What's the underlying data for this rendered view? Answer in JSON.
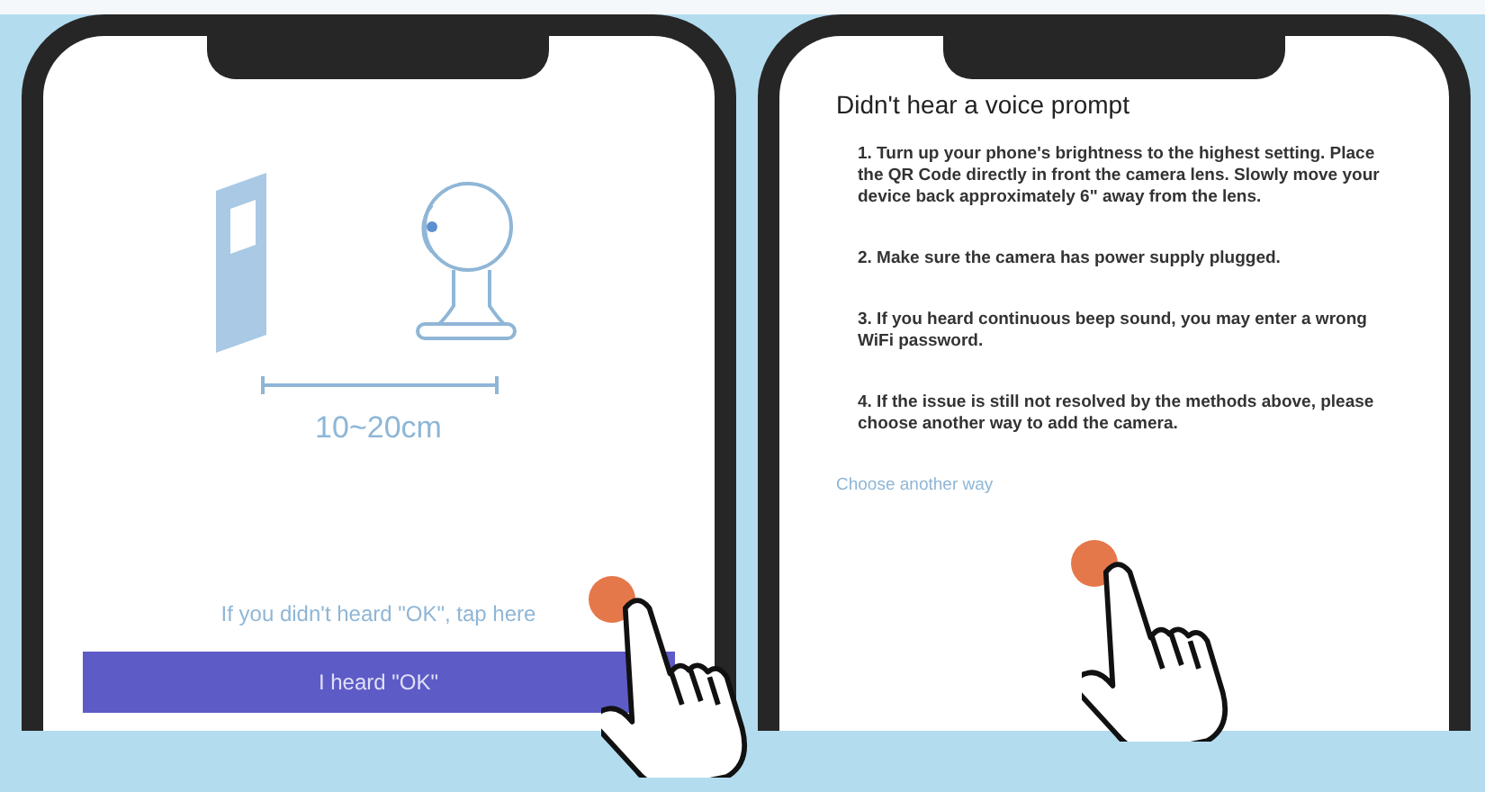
{
  "left_screen": {
    "distance_label": "10~20cm",
    "link": "If you didn't heard \"OK\", tap here",
    "button": "I heard \"OK\""
  },
  "right_screen": {
    "title": "Didn't hear a voice prompt",
    "steps": [
      "1. Turn up your phone's brightness to the highest setting. Place the QR Code directly in front the camera lens. Slowly move your device back approximately 6\" away from the lens.",
      "2. Make sure the camera has power supply plugged.",
      "3. If you heard continuous beep sound, you may enter a wrong WiFi password.",
      "4. If the issue is still not resolved by the methods above, please choose another way to add the camera."
    ],
    "link": "Choose another way"
  }
}
